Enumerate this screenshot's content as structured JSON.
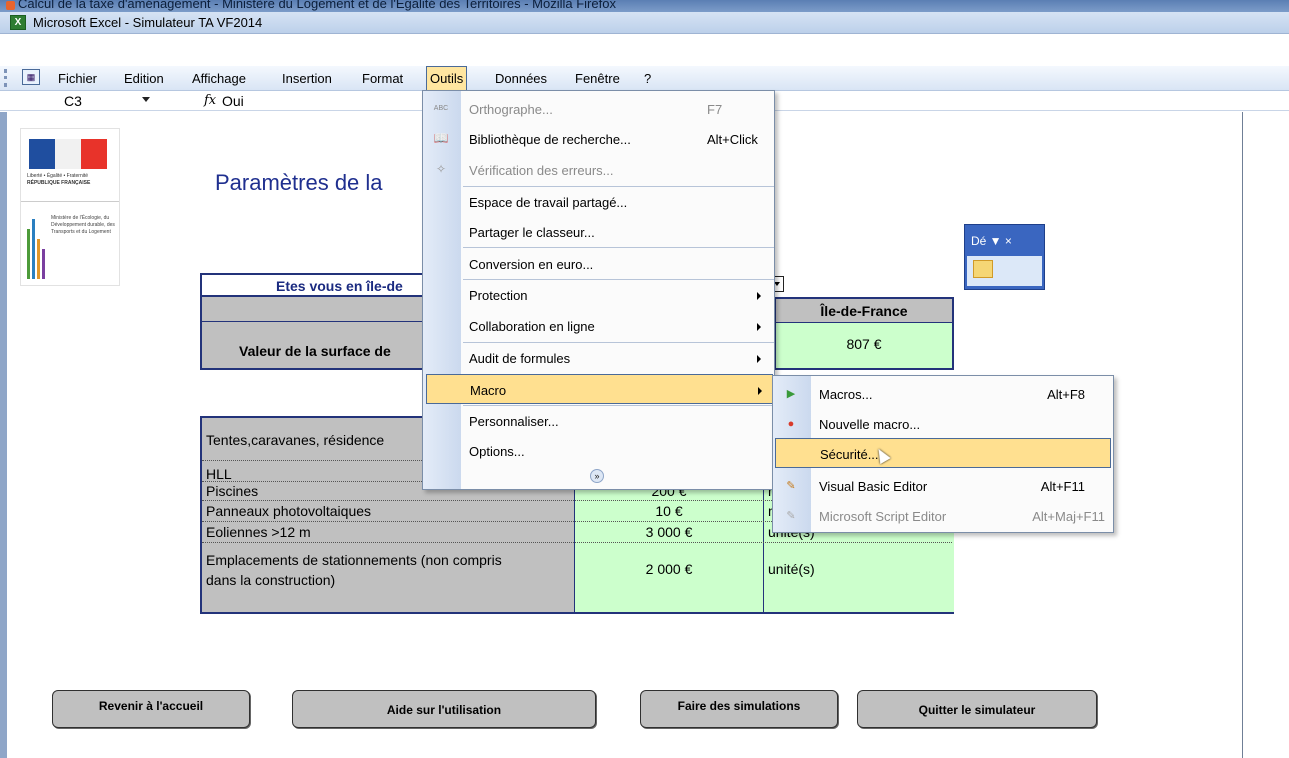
{
  "firefox": {
    "title": "Calcul de la taxe d'aménagement - Ministère du Logement et de l'Egalité des Territoires - Mozilla Firefox"
  },
  "excel": {
    "title": "Microsoft Excel - Simulateur TA VF2014",
    "menubar": [
      "Fichier",
      "Edition",
      "Affichage",
      "Insertion",
      "Format",
      "Outils",
      "Données",
      "Fenêtre",
      "?"
    ]
  },
  "formula_bar": {
    "cell": "C3",
    "fx": "fx",
    "value": "Oui"
  },
  "logo": {
    "line1": "Liberté • Égalité • Fraternité",
    "line2": "RÉPUBLIQUE FRANÇAISE",
    "ministry": "Ministère de l'Écologie, du Développement durable, des Transports et du Logement"
  },
  "sheet": {
    "title": "Paramètres de la",
    "question": "Etes vous en île-de",
    "surface_label": "Valeur de la surface de",
    "idf_header": "Île-de-France",
    "idf_value": "807 €",
    "rows": [
      {
        "label": "Tentes,caravanes, résidence",
        "value": "",
        "unit": ""
      },
      {
        "label": "HLL",
        "value": "",
        "unit": ""
      },
      {
        "label": "Piscines",
        "value": "200 €",
        "unit": "m"
      },
      {
        "label": "Panneaux photovoltaiques",
        "value": "10 €",
        "unit": "m"
      },
      {
        "label": "Eoliennes >12 m",
        "value": "3 000 €",
        "unit": "unité(s)"
      },
      {
        "label": "Emplacements de stationnements (non compris",
        "label2": "dans la construction)",
        "value": "2 000 €",
        "unit": "unité(s)"
      }
    ],
    "buttons": [
      "Revenir à l'accueil",
      "Aide sur l'utilisation",
      "Faire des simulations",
      "Quitter le simulateur"
    ]
  },
  "floating_toolbar": {
    "title": "Dé ▼ ×"
  },
  "outils_menu": [
    {
      "label": "Orthographe...",
      "shortcut": "F7",
      "disabled": true,
      "icon": "ABC"
    },
    {
      "label": "Bibliothèque de recherche...",
      "shortcut": "Alt+Click",
      "disabled": false,
      "icon": "📖"
    },
    {
      "label": "Vérification des erreurs...",
      "shortcut": "",
      "disabled": true,
      "icon": "✧"
    },
    {
      "label": "Espace de travail partagé...",
      "shortcut": "",
      "disabled": false
    },
    {
      "label": "Partager le classeur...",
      "shortcut": "",
      "disabled": false
    },
    {
      "label": "Conversion en euro...",
      "shortcut": "",
      "disabled": false
    },
    {
      "label": "Protection",
      "shortcut": "",
      "disabled": false,
      "submenu": true
    },
    {
      "label": "Collaboration en ligne",
      "shortcut": "",
      "disabled": false,
      "submenu": true
    },
    {
      "label": "Audit de formules",
      "shortcut": "",
      "disabled": false,
      "submenu": true
    },
    {
      "label": "Macro",
      "shortcut": "",
      "disabled": false,
      "submenu": true,
      "highlighted": true
    },
    {
      "label": "Personnaliser...",
      "shortcut": "",
      "disabled": false
    },
    {
      "label": "Options...",
      "shortcut": "",
      "disabled": false
    }
  ],
  "macro_submenu": [
    {
      "label": "Macros...",
      "shortcut": "Alt+F8",
      "disabled": false,
      "icon": "▶"
    },
    {
      "label": "Nouvelle macro...",
      "shortcut": "",
      "disabled": false,
      "icon": "●"
    },
    {
      "label": "Sécurité...",
      "shortcut": "",
      "disabled": false,
      "highlighted": true
    },
    {
      "label": "Visual Basic Editor",
      "shortcut": "Alt+F11",
      "disabled": false,
      "icon": "✎"
    },
    {
      "label": "Microsoft Script Editor",
      "shortcut": "Alt+Maj+F11",
      "disabled": true,
      "icon": "✎"
    }
  ],
  "expand_glyph": "»"
}
